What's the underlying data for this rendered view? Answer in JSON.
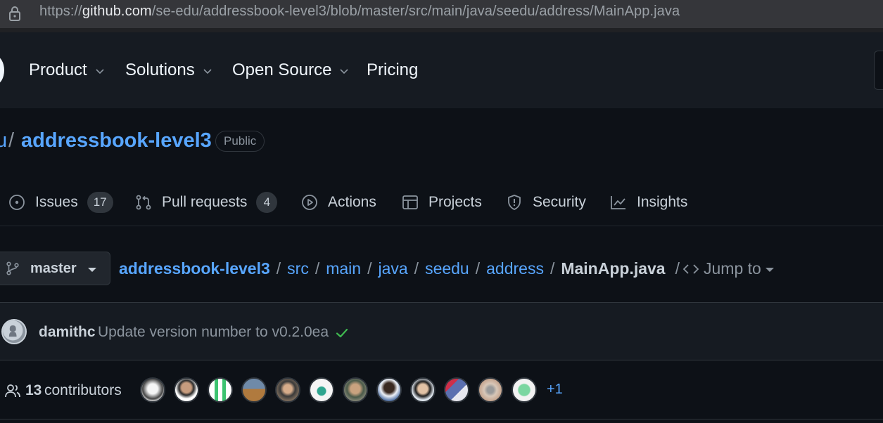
{
  "browser": {
    "url_prefix": "https://",
    "url_host": "github.com",
    "url_path": "/se-edu/addressbook-level3/blob/master/src/main/java/seedu/address/MainApp.java"
  },
  "header": {
    "nav": [
      {
        "label": "Product",
        "has_dropdown": true
      },
      {
        "label": "Solutions",
        "has_dropdown": true
      },
      {
        "label": "Open Source",
        "has_dropdown": true
      },
      {
        "label": "Pricing",
        "has_dropdown": false
      }
    ]
  },
  "repo": {
    "owner_fragment": "u",
    "separator": "/",
    "name": "addressbook-level3",
    "visibility": "Public"
  },
  "tabs": [
    {
      "label": "Issues",
      "icon": "issue-opened-icon",
      "count": "17"
    },
    {
      "label": "Pull requests",
      "icon": "git-pull-request-icon",
      "count": "4"
    },
    {
      "label": "Actions",
      "icon": "play-icon"
    },
    {
      "label": "Projects",
      "icon": "table-icon"
    },
    {
      "label": "Security",
      "icon": "shield-icon"
    },
    {
      "label": "Insights",
      "icon": "graph-icon"
    }
  ],
  "file_nav": {
    "branch": "master",
    "breadcrumbs": [
      "addressbook-level3",
      "src",
      "main",
      "java",
      "seedu",
      "address"
    ],
    "crumb_separator": "/",
    "file_name": "MainApp.java",
    "jump_to": "Jump to"
  },
  "commit": {
    "author": "damithc",
    "message": "Update version number to v0.2.0ea",
    "status": "success"
  },
  "contributors": {
    "count": "13",
    "label": "contributors",
    "more": "+1"
  },
  "colors": {
    "background": "#0d1117",
    "header": "#161b22",
    "link": "#58a6ff",
    "success": "#3fb950"
  }
}
